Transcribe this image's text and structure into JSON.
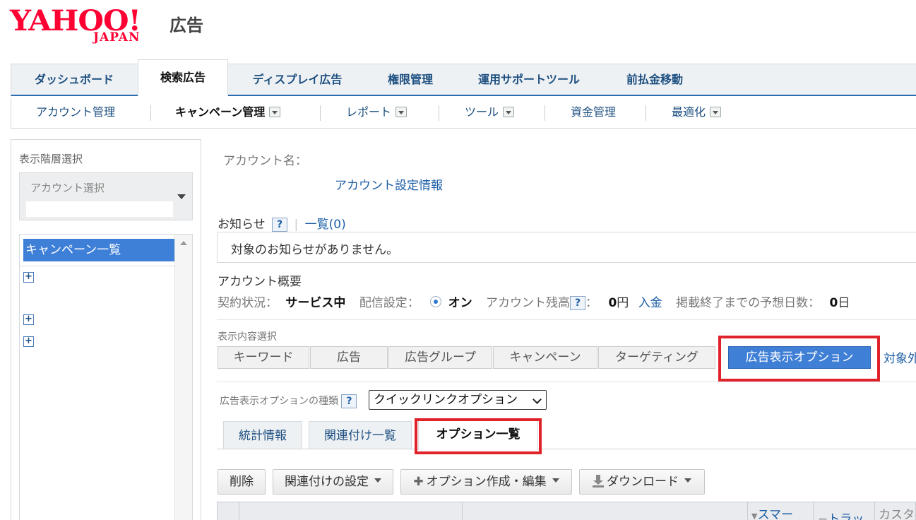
{
  "logo": {
    "yahoo": "YAHOO!",
    "japan": "JAPAN",
    "ad": "広告"
  },
  "top_tabs": [
    "ダッシュボード",
    "検索広告",
    "ディスプレイ広告",
    "権限管理",
    "運用サポートツール",
    "前払金移動"
  ],
  "top_tab_active": "検索広告",
  "sub_nav": {
    "account_mgmt": "アカウント管理",
    "campaign_mgmt": "キャンペーン管理",
    "report": "レポート",
    "tools": "ツール",
    "funds": "資金管理",
    "optimize": "最適化"
  },
  "sidebar": {
    "title": "表示階層選択",
    "account_select": "アカウント選択",
    "campaign_list": "キャンペーン一覧"
  },
  "account": {
    "name_label": "アカウント名：",
    "settings_link": "アカウント設定情報"
  },
  "notice": {
    "label": "お知らせ",
    "list_link": "一覧(0)",
    "empty": "対象のお知らせがありません。"
  },
  "overview": {
    "title": "アカウント概要",
    "contract_label": "契約状況：",
    "contract_value": "サービス中",
    "delivery_label": "配信設定：",
    "delivery_value": "オン",
    "balance_label": "アカウント残高",
    "balance_colon": "：",
    "balance_value": "0",
    "balance_unit": "円",
    "deposit_link": "入金",
    "days_label": "掲載終了までの予想日数：",
    "days_value": "0",
    "days_unit": "日"
  },
  "display_select": {
    "label": "表示内容選択",
    "tabs": [
      "キーワード",
      "広告",
      "広告グループ",
      "キャンペーン",
      "ターゲティング",
      "広告表示オプション"
    ],
    "active": "広告表示オプション",
    "extra_link": "対象外"
  },
  "option_type": {
    "label": "広告表示オプションの種類",
    "selected": "クイックリンクオプション"
  },
  "sub_tabs": [
    "統計情報",
    "関連付け一覧",
    "オプション一覧"
  ],
  "sub_tab_active": "オプション一覧",
  "buttons": {
    "delete": "削除",
    "association": "関連付けの設定",
    "create": "オプション作成・編集",
    "download": "ダウンロード"
  },
  "table_headers": {
    "smart": "スマー",
    "track": "トラッ",
    "custom": "カスタ"
  },
  "colors": {
    "accent": "#3f7fd6",
    "highlight": "#e0232b",
    "brand": "#ff0033"
  }
}
